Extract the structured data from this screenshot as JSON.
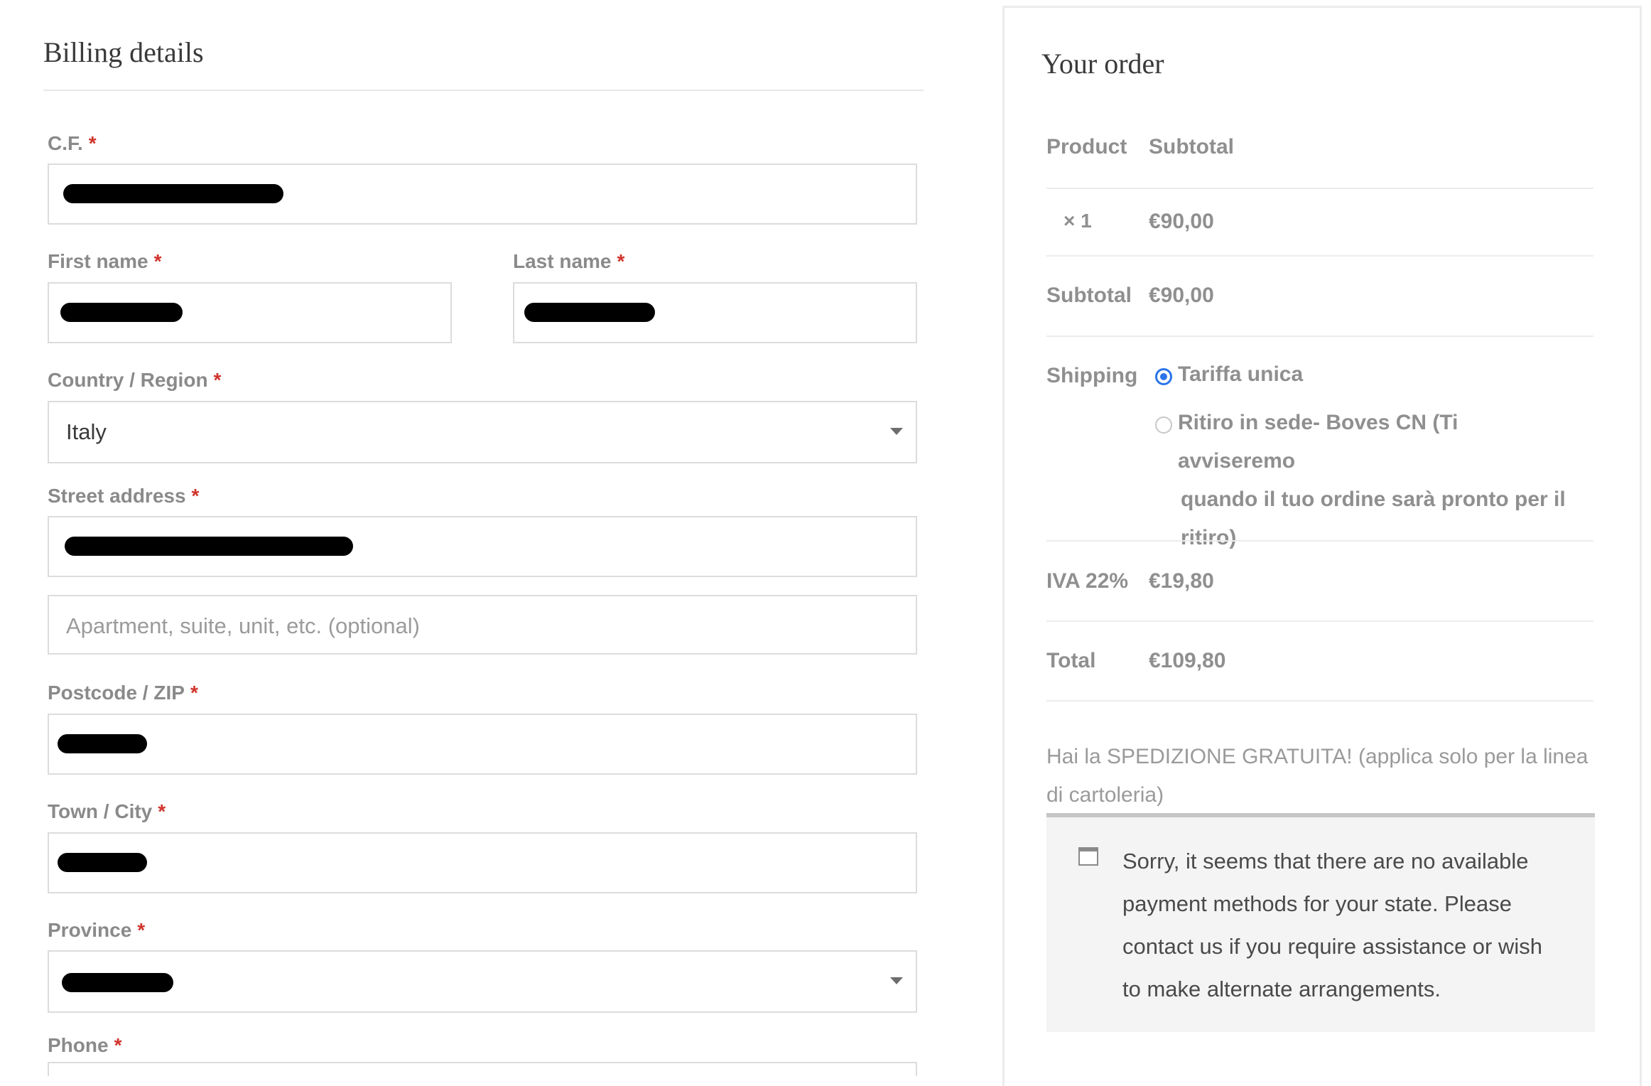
{
  "billing": {
    "title": "Billing details",
    "fields": {
      "cf": {
        "label": "C.F."
      },
      "first_name": {
        "label": "First name"
      },
      "last_name": {
        "label": "Last name"
      },
      "country": {
        "label": "Country / Region",
        "value": "Italy"
      },
      "street": {
        "label": "Street address",
        "placeholder2": "Apartment, suite, unit, etc. (optional)"
      },
      "postcode": {
        "label": "Postcode / ZIP"
      },
      "city": {
        "label": "Town / City"
      },
      "province": {
        "label": "Province"
      },
      "phone": {
        "label": "Phone"
      }
    },
    "required_mark": "*"
  },
  "order": {
    "title": "Your order",
    "header": {
      "product": "Product",
      "subtotal": "Subtotal"
    },
    "item": {
      "qty": "× 1",
      "price": "€90,00"
    },
    "subtotal": {
      "label": "Subtotal",
      "value": "€90,00"
    },
    "shipping": {
      "label": "Shipping",
      "options": [
        {
          "label": "Tariffa unica",
          "selected": true
        },
        {
          "label_lines": [
            "Ritiro in sede- Boves CN (Ti avviseremo",
            "quando il tuo ordine sarà pronto per il",
            "ritiro)"
          ],
          "selected": false
        }
      ]
    },
    "tax": {
      "label": "IVA 22%",
      "value": "€19,80"
    },
    "total": {
      "label": "Total",
      "value": "€109,80"
    },
    "note": "Hai la SPEDIZIONE GRATUITA! (applica solo per la linea di cartoleria)",
    "payment_message": "Sorry, it seems that there are no available payment methods for your state. Please contact us if you require assistance or wish to make alternate arrangements."
  },
  "colors": {
    "required": "#d0342c",
    "radio_selected": "#2b74ea",
    "redaction": "#000000"
  }
}
